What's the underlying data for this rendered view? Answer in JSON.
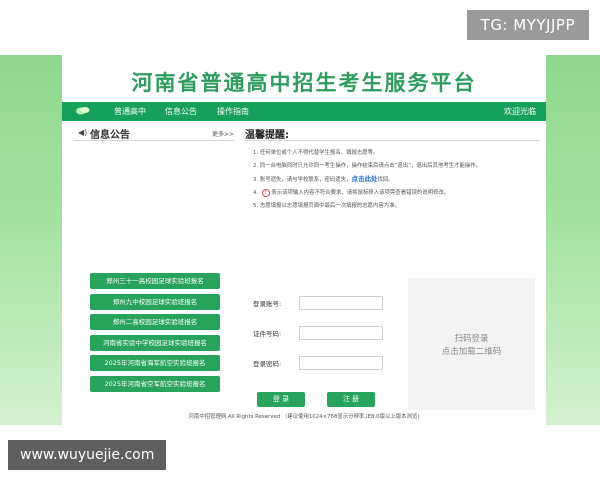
{
  "watermark_top": "TG: MYYJJPP",
  "watermark_bottom": "www.wuyuejie.com",
  "site": {
    "title": "河南省普通高中招生考生服务平台",
    "brand_color": "#16a05a"
  },
  "nav": {
    "items": [
      "普通高中",
      "信息公告",
      "操作指南"
    ],
    "welcome": "欢迎光临"
  },
  "notice": {
    "title": "信息公告",
    "more": "更多>>",
    "projects": [
      "郑州三十一高校园足球实验班报名",
      "郑州九中校园足球实验班报名",
      "郑州二高校园足球实验班报名",
      "河南省实验中学校园足球实验班报名",
      "2025年河南省海军航空实验班报名",
      "2025年河南省空军航空实验班报名"
    ]
  },
  "tips": {
    "title": "温馨提醒:",
    "line1": "1. 任何单位或个人不得代替学生报名、填报志愿等。",
    "line2": "2. 同一台电脑同时只允许同一考生操作，操作结束后请点击“退出”，退出后其他考生才能操作。",
    "line3_pre": "3. 账号遗失，请与学校联系，密码遗失，",
    "line3_link": "点击此处",
    "line3_post": "找回。",
    "line4_num": "4.",
    "line4_icon": "!",
    "line4_text": "表示该项输入内容不符合要求，请将鼠标移入该项旁查看错误的说明修改。",
    "line5": "5. 志愿填报以志愿填报页面中最后一次填报的志愿内容为准。"
  },
  "login": {
    "account_label": "登录账号:",
    "id_label": "证件号码:",
    "password_label": "登录密码:",
    "login_button": "登 录",
    "register_button": "注 册"
  },
  "qr": {
    "line1": "扫码登录",
    "line2": "点击加载二维码"
  },
  "footer": "河南中招管理网 All Rights Reserved （建议使用1024×768显示分辨率,IE8.0版以上版本浏览)"
}
